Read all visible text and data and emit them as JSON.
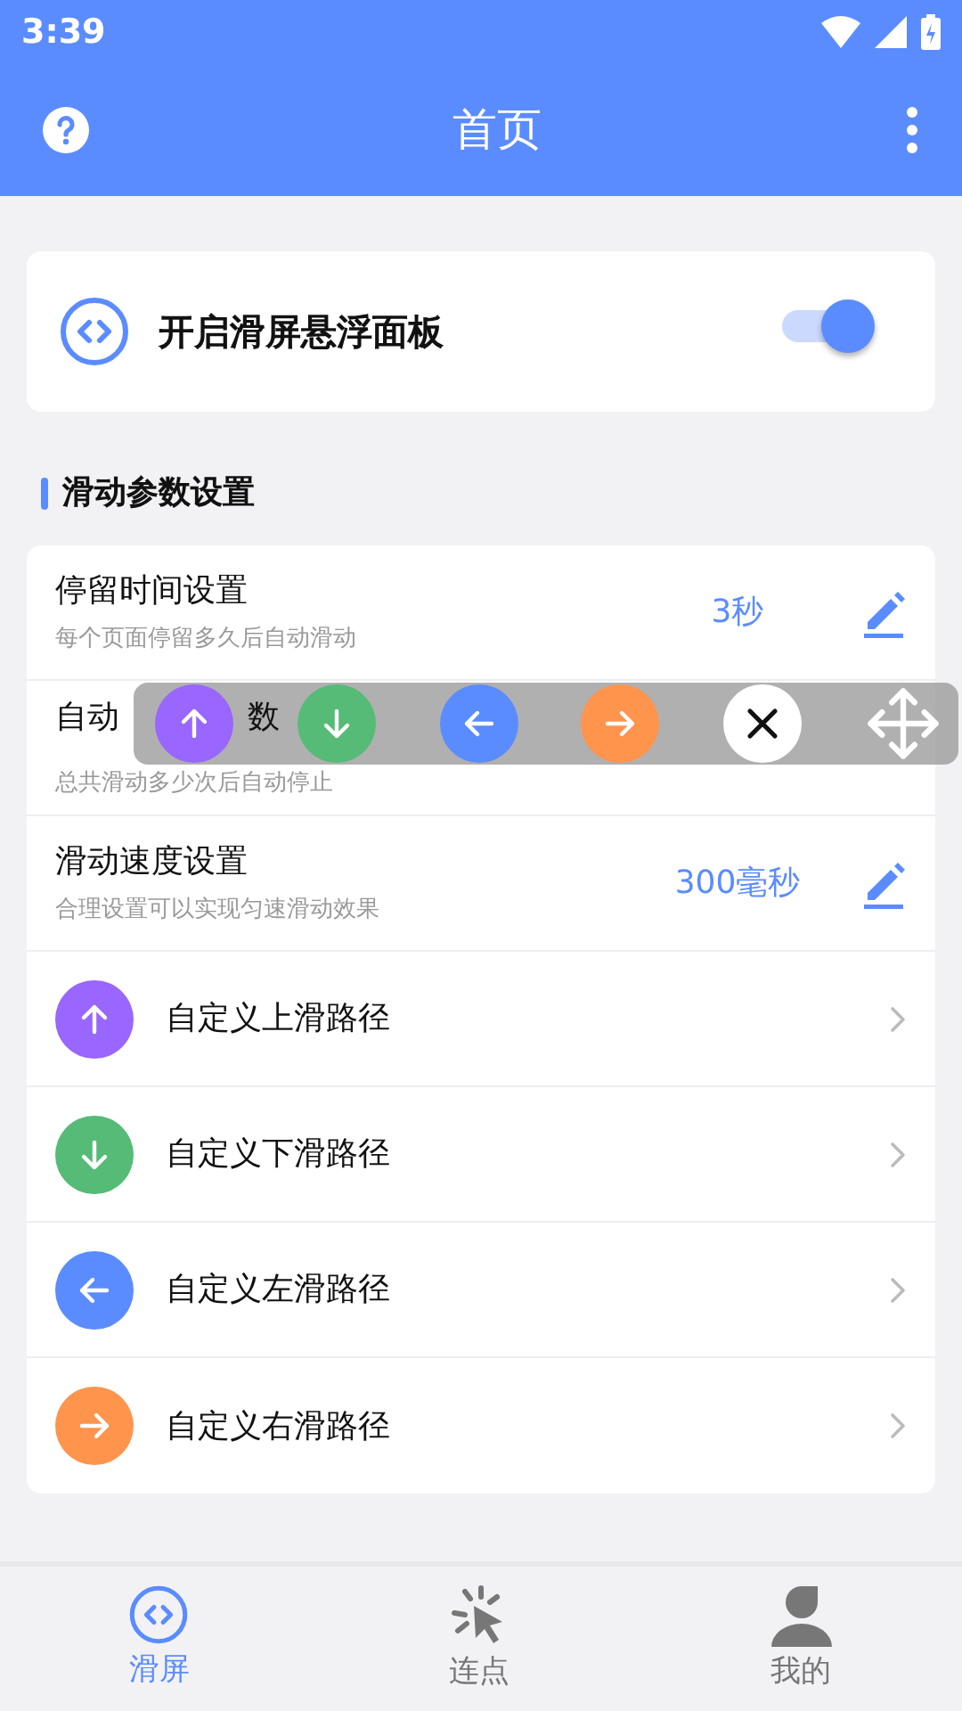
{
  "status_bar": {
    "time": "3:39"
  },
  "app_bar": {
    "title": "首页"
  },
  "float_switch": {
    "label": "开启滑屏悬浮面板",
    "on": true
  },
  "section": {
    "title": "滑动参数设置"
  },
  "settings": [
    {
      "kind": "value",
      "title": "停留时间设置",
      "subtitle": "每个页面停留多久后自动滑动",
      "value": "3秒"
    },
    {
      "kind": "covered",
      "title_parts": [
        "自动",
        "数"
      ],
      "subtitle": "总共滑动多少次后自动停止"
    },
    {
      "kind": "value",
      "title": "滑动速度设置",
      "subtitle": "合理设置可以实现匀速滑动效果",
      "value": "300毫秒"
    },
    {
      "kind": "up",
      "color": "#9966ff",
      "title": "自定义上滑路径"
    },
    {
      "kind": "down",
      "color": "#55bb77",
      "title": "自定义下滑路径"
    },
    {
      "kind": "left",
      "color": "#5b8cff",
      "title": "自定义左滑路径"
    },
    {
      "kind": "right",
      "color": "#ff944d",
      "title": "自定义右滑路径"
    }
  ],
  "floating_panel": [
    {
      "kind": "up",
      "color": "#9966ff"
    },
    {
      "kind": "down",
      "color": "#55bb77"
    },
    {
      "kind": "left",
      "color": "#5b8cff"
    },
    {
      "kind": "right",
      "color": "#ff944d"
    },
    {
      "kind": "close"
    },
    {
      "kind": "move"
    }
  ],
  "bottom_nav": [
    {
      "kind": "swipe",
      "label": "滑屏",
      "selected": true
    },
    {
      "kind": "tap",
      "label": "连点",
      "selected": false
    },
    {
      "kind": "profile",
      "label": "我的",
      "selected": false
    }
  ]
}
